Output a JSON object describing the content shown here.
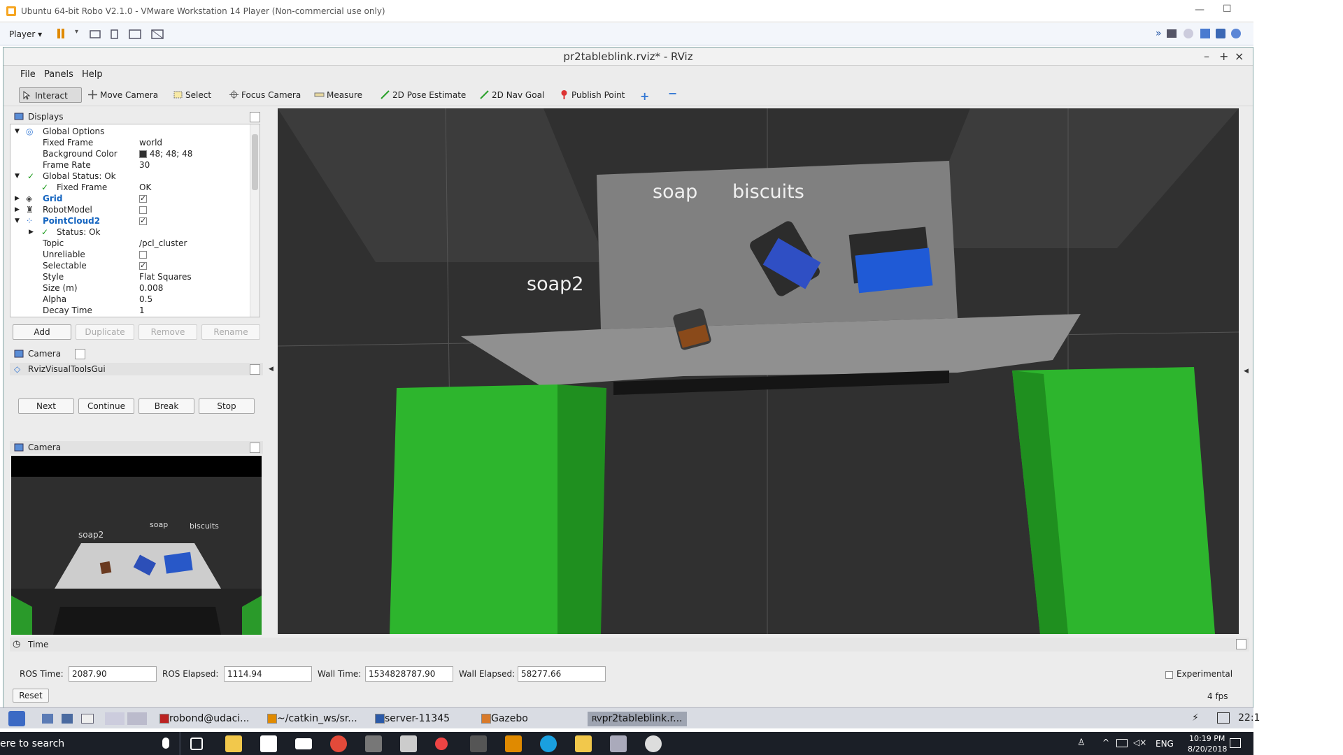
{
  "vm": {
    "title": "Ubuntu 64-bit Robo V2.1.0 - VMware Workstation 14 Player (Non-commercial use only)",
    "player_menu": "Player"
  },
  "rviz": {
    "title": "pr2tableblink.rviz* - RViz",
    "menu": {
      "file": "File",
      "panels": "Panels",
      "help": "Help"
    },
    "tools": [
      {
        "label": "Interact",
        "icon": "interact-icon"
      },
      {
        "label": "Move Camera",
        "icon": "move-camera-icon"
      },
      {
        "label": "Select",
        "icon": "select-icon"
      },
      {
        "label": "Focus Camera",
        "icon": "focus-camera-icon"
      },
      {
        "label": "Measure",
        "icon": "measure-icon"
      },
      {
        "label": "2D Pose Estimate",
        "icon": "pose-arrow-icon"
      },
      {
        "label": "2D Nav Goal",
        "icon": "nav-goal-icon"
      },
      {
        "label": "Publish Point",
        "icon": "publish-point-icon"
      }
    ],
    "displays": {
      "title": "Displays",
      "rows": [
        {
          "key": "Global Options",
          "value": ""
        },
        {
          "key": "Fixed Frame",
          "value": "world"
        },
        {
          "key": "Background Color",
          "value": "48; 48; 48"
        },
        {
          "key": "Frame Rate",
          "value": "30"
        },
        {
          "key": "Global Status: Ok",
          "value": ""
        },
        {
          "key": "Fixed Frame",
          "value": "OK"
        },
        {
          "key": "Grid",
          "value": ""
        },
        {
          "key": "RobotModel",
          "value": ""
        },
        {
          "key": "PointCloud2",
          "value": ""
        },
        {
          "key": "Status: Ok",
          "value": ""
        },
        {
          "key": "Topic",
          "value": "/pcl_cluster"
        },
        {
          "key": "Unreliable",
          "value": ""
        },
        {
          "key": "Selectable",
          "value": ""
        },
        {
          "key": "Style",
          "value": "Flat Squares"
        },
        {
          "key": "Size (m)",
          "value": "0.008"
        },
        {
          "key": "Alpha",
          "value": "0.5"
        },
        {
          "key": "Decay Time",
          "value": "1"
        }
      ],
      "buttons": {
        "add": "Add",
        "duplicate": "Duplicate",
        "remove": "Remove",
        "rename": "Rename"
      }
    },
    "camera_label": "Camera",
    "rvt_label": "RvizVisualToolsGui",
    "rvt_buttons": {
      "next": "Next",
      "continue": "Continue",
      "break": "Break",
      "stop": "Stop"
    },
    "camera_panel_label": "Camera",
    "labels3d": {
      "soap": "soap",
      "biscuits": "biscuits",
      "soap2": "soap2"
    },
    "time": {
      "title": "Time",
      "ros_time_label": "ROS Time:",
      "ros_time": "2087.90",
      "ros_elapsed_label": "ROS Elapsed:",
      "ros_elapsed": "1114.94",
      "wall_time_label": "Wall Time:",
      "wall_time": "1534828787.90",
      "wall_elapsed_label": "Wall Elapsed:",
      "wall_elapsed": "58277.66",
      "experimental": "Experimental",
      "reset": "Reset",
      "fps": "4 fps"
    }
  },
  "lxde": {
    "tasks": [
      "robond@udaci...",
      "~/catkin_ws/sr...",
      "server-11345",
      "Gazebo",
      "pr2tableblink.r..."
    ],
    "clock": "22:1"
  },
  "windows": {
    "search": "ere to search",
    "lang": "ENG",
    "time": "10:19 PM",
    "date": "8/20/2018"
  }
}
